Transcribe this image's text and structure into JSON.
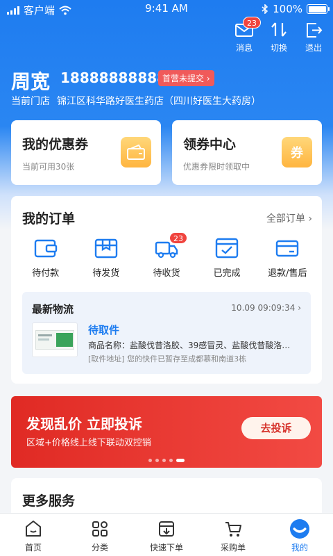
{
  "status_bar": {
    "carrier": "客户端",
    "time": "9:41 AM",
    "battery": "100%"
  },
  "top_actions": [
    {
      "label": "消息",
      "badge": "23"
    },
    {
      "label": "切换"
    },
    {
      "label": "退出"
    }
  ],
  "user": {
    "name": "周宽",
    "phone": "18888888888",
    "tag": "首营未提交",
    "store_label": "当前门店",
    "store_name": "锦江区科华路好医生药店（四川好医生大药房）"
  },
  "coupons": {
    "mine_title": "我的优惠券",
    "mine_sub": "当前可用30张",
    "center_title": "领券中心",
    "center_sub": "优惠券限时领取中",
    "center_icon_text": "券"
  },
  "orders": {
    "title": "我的订单",
    "all_label": "全部订单",
    "items": [
      {
        "label": "待付款",
        "icon": "wallet-icon"
      },
      {
        "label": "待发货",
        "icon": "package-icon"
      },
      {
        "label": "待收货",
        "icon": "truck-icon",
        "badge": "23"
      },
      {
        "label": "已完成",
        "icon": "check-icon"
      },
      {
        "label": "退款/售后",
        "icon": "refund-icon"
      }
    ],
    "logistics": {
      "title": "最新物流",
      "time": "10.09 09:09:34",
      "status": "待取件",
      "product_line": "商品名称：盐酸伐昔洛胶、39感冒灵、盐酸伐昔酸洛…",
      "pickup_line": "[取件地址]  您的快件已暂存至成都慕和南道3栋"
    }
  },
  "banner": {
    "title": "发现乱价  立即投诉",
    "subtitle": "区域+价格线上线下联动双控销",
    "button": "去投诉",
    "active_dot": 5,
    "dot_count": 5
  },
  "more_services": {
    "title": "更多服务"
  },
  "tabbar": [
    {
      "label": "首页",
      "icon": "home-icon"
    },
    {
      "label": "分类",
      "icon": "category-icon"
    },
    {
      "label": "快速下单",
      "icon": "quick-order-icon"
    },
    {
      "label": "采购单",
      "icon": "cart-icon"
    },
    {
      "label": "我的",
      "icon": "profile-icon",
      "active": true
    }
  ],
  "colors": {
    "primary": "#1d7cf0",
    "badge": "#f0443e",
    "banner": "#e02a24",
    "coupon_icon": "#ffb53f"
  }
}
